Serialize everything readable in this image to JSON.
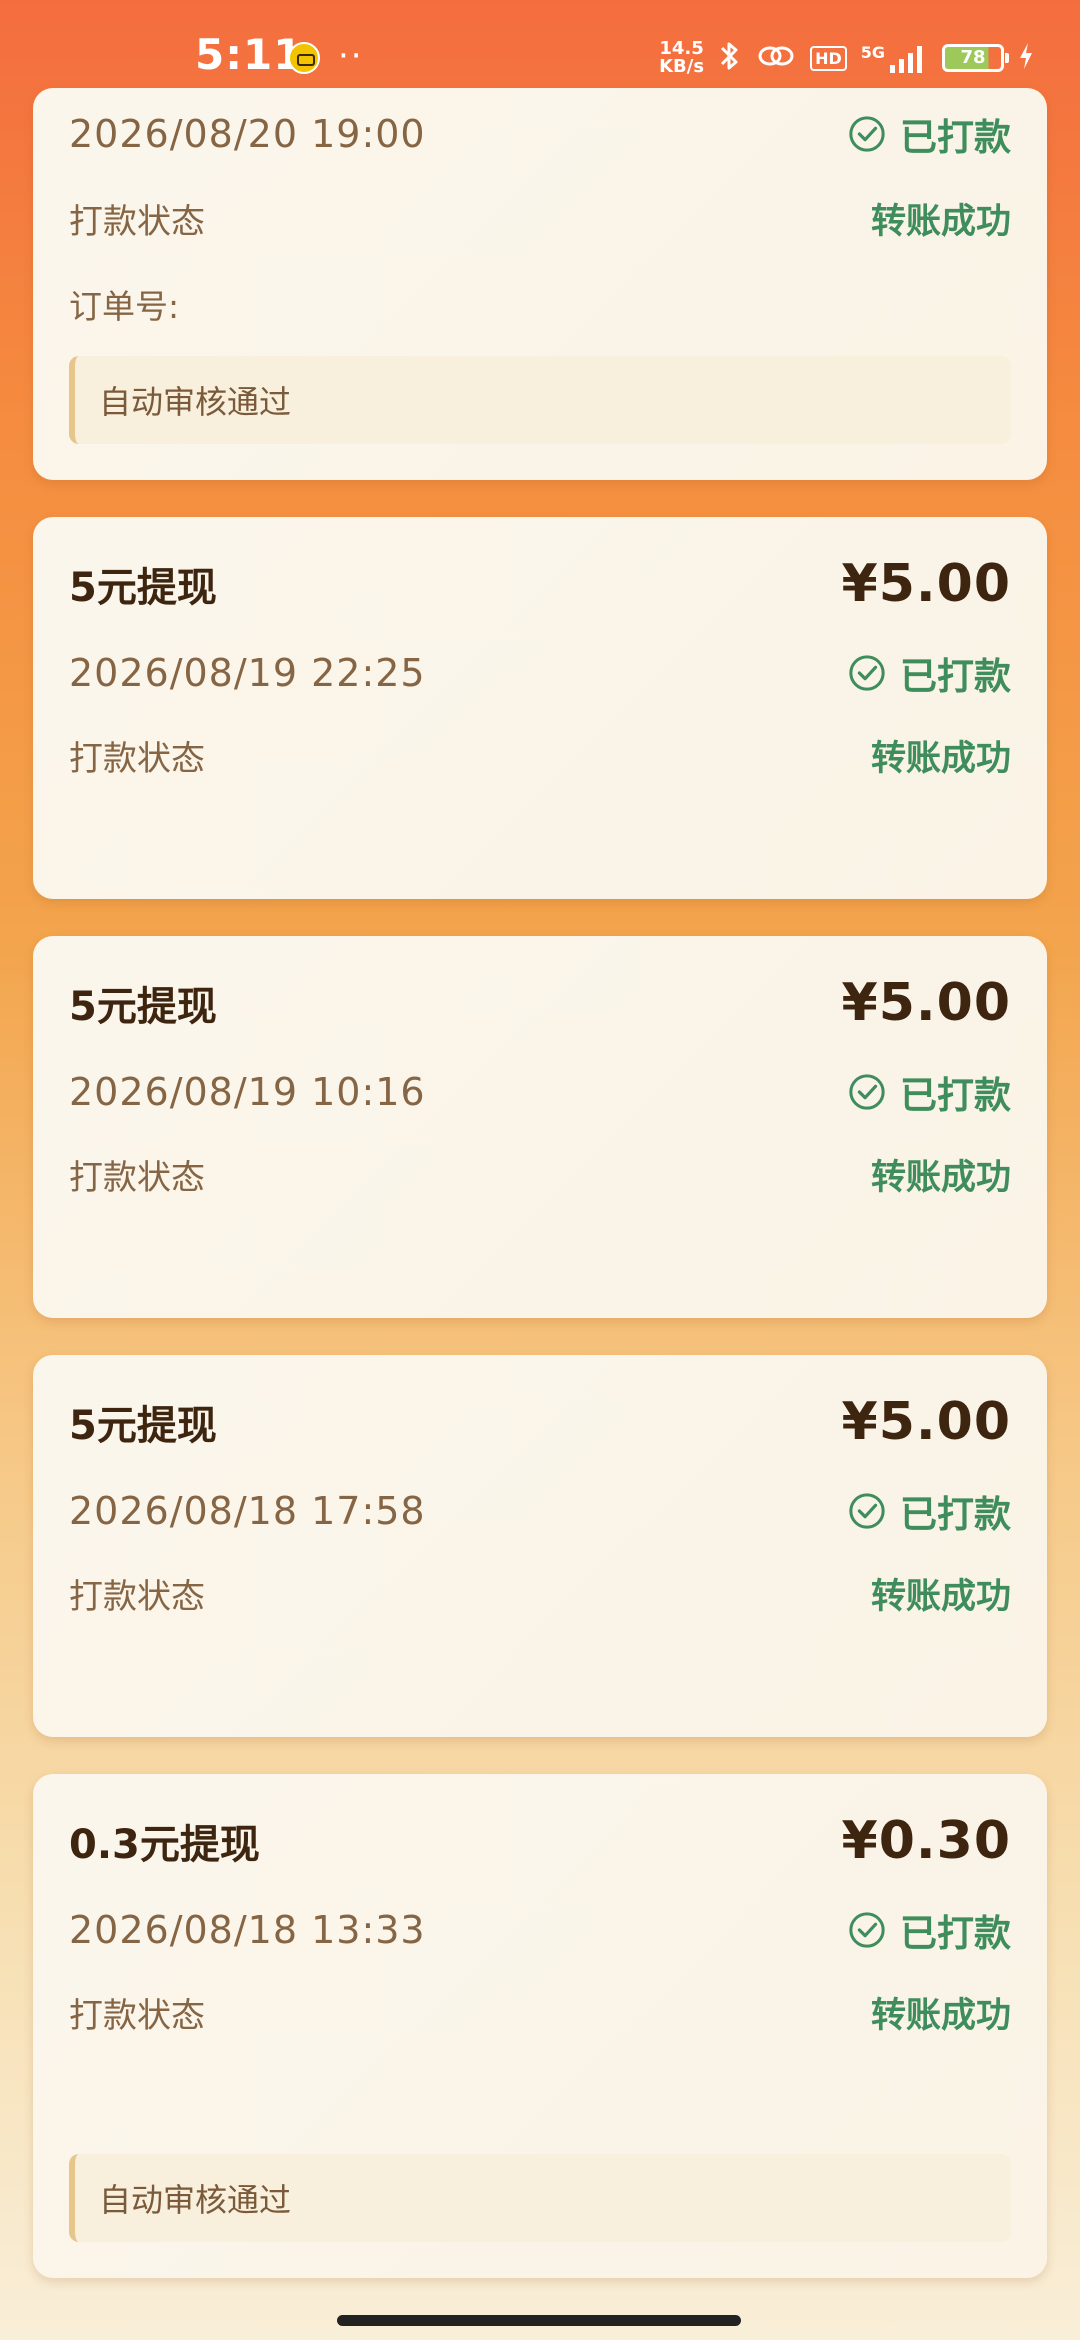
{
  "status_bar": {
    "time": "5:11",
    "dots": "··",
    "net_speed_value": "14.5",
    "net_speed_unit": "KB/s",
    "hd": "HD",
    "network": "5G",
    "battery": "78"
  },
  "cards": [
    {
      "date": "2026/08/20 19:00",
      "paid_status": "已打款",
      "state_label": "打款状态",
      "state_value": "转账成功",
      "order_label": "订单号:",
      "note": "自动审核通过"
    },
    {
      "title": "5元提现",
      "amount": "¥5.00",
      "date": "2026/08/19 22:25",
      "paid_status": "已打款",
      "state_label": "打款状态",
      "state_value": "转账成功"
    },
    {
      "title": "5元提现",
      "amount": "¥5.00",
      "date": "2026/08/19 10:16",
      "paid_status": "已打款",
      "state_label": "打款状态",
      "state_value": "转账成功"
    },
    {
      "title": "5元提现",
      "amount": "¥5.00",
      "date": "2026/08/18 17:58",
      "paid_status": "已打款",
      "state_label": "打款状态",
      "state_value": "转账成功"
    },
    {
      "title": "0.3元提现",
      "amount": "¥0.30",
      "date": "2026/08/18 13:33",
      "paid_status": "已打款",
      "state_label": "打款状态",
      "state_value": "转账成功",
      "note": "自动审核通过"
    }
  ],
  "colors": {
    "accent_green": "#3f8d5c",
    "text_dark": "#3e2510",
    "text_muted": "#866544"
  }
}
